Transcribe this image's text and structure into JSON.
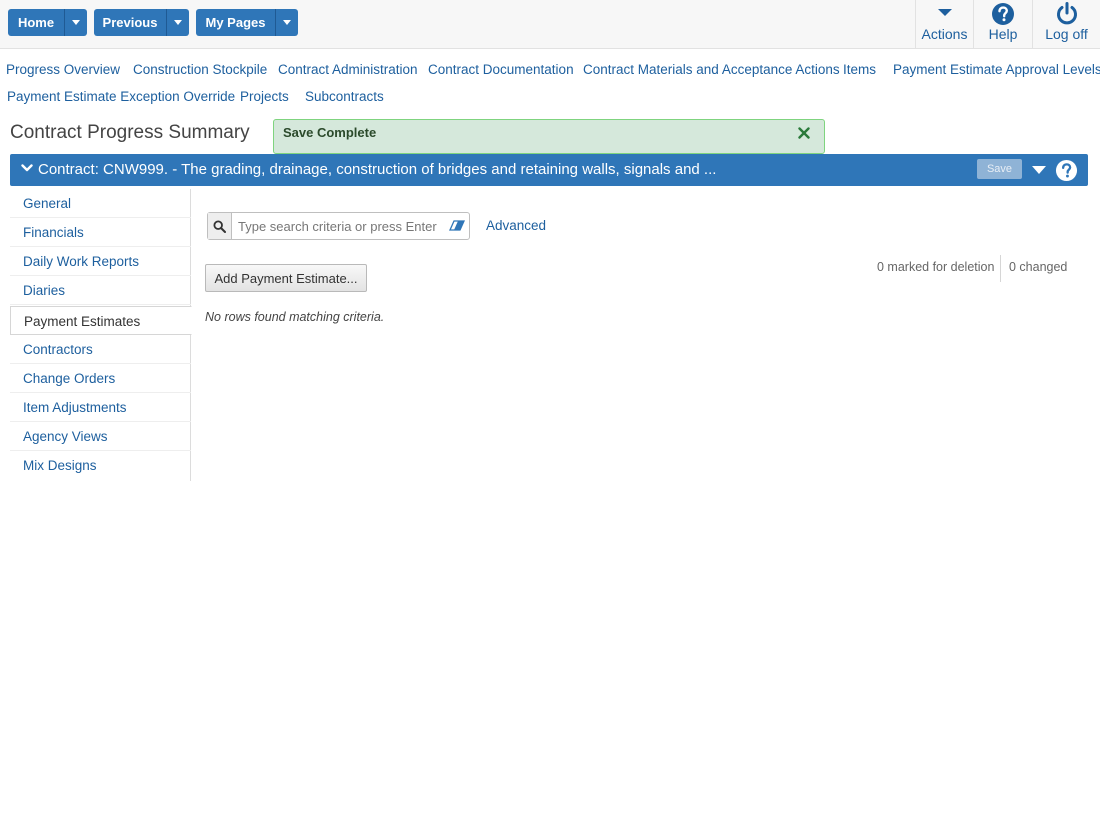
{
  "toolbar": {
    "home_label": "Home",
    "previous_label": "Previous",
    "mypages_label": "My Pages",
    "actions_label": "Actions",
    "help_label": "Help",
    "logoff_label": "Log off",
    "accent": "#2f76b8"
  },
  "links": [
    "Progress Overview",
    "Construction Stockpile",
    "Contract Administration",
    "Contract Documentation",
    "Contract Materials and Acceptance Actions",
    "Items",
    "Payment Estimate Approval Levels",
    "Payment Estimate Exception Override",
    "Projects",
    "Subcontracts"
  ],
  "page_title": "Contract Progress Summary",
  "toast": {
    "message": "Save Complete",
    "close_icon": "close-icon"
  },
  "contract": {
    "title": "Contract: CNW999. - The grading, drainage, construction of bridges and retaining walls, signals and ...",
    "save_label": "Save"
  },
  "sidenav": {
    "items": [
      "General",
      "Financials",
      "Daily Work Reports",
      "Diaries",
      "Payment Estimates",
      "Contractors",
      "Change Orders",
      "Item Adjustments",
      "Agency Views",
      "Mix Designs"
    ],
    "active": "Payment Estimates"
  },
  "search": {
    "placeholder": "Type search criteria or press Enter",
    "value": "",
    "advanced_label": "Advanced"
  },
  "grid": {
    "add_label": "Add Payment Estimate...",
    "marked_for_deletion": "0 marked for deletion",
    "changed": "0 changed",
    "empty_message": "No rows found matching criteria."
  }
}
